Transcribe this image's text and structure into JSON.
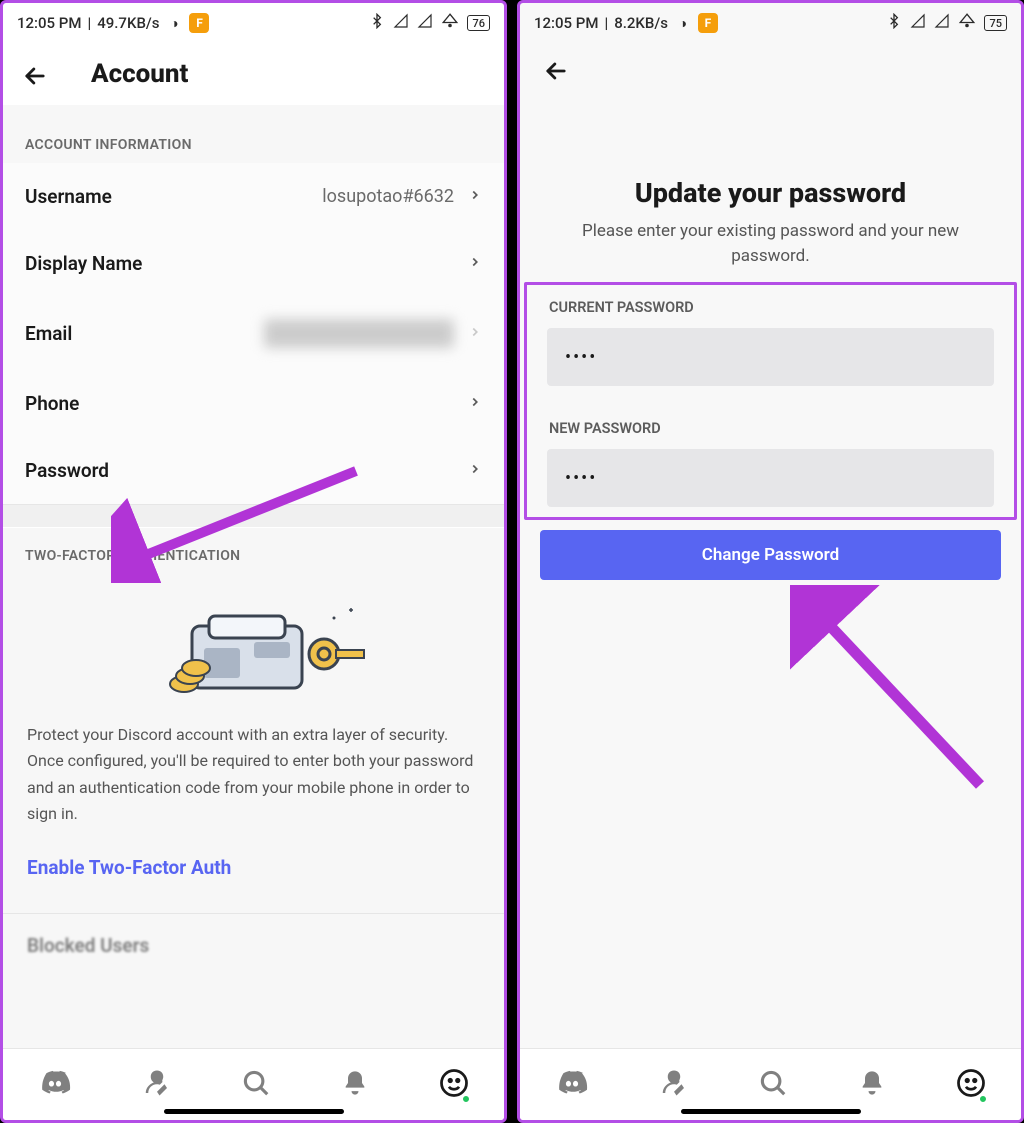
{
  "status": {
    "time": "12:05 PM",
    "left_rate": "49.7KB/s",
    "right_rate": "8.2KB/s",
    "battery_left": "76",
    "battery_right": "75"
  },
  "left": {
    "header_title": "Account",
    "section_info": "ACCOUNT INFORMATION",
    "rows": {
      "username_label": "Username",
      "username_value": "losupotao#6632",
      "display_name_label": "Display Name",
      "email_label": "Email",
      "phone_label": "Phone",
      "password_label": "Password"
    },
    "twofa_section": "TWO-FACTOR AUTHENTICATION",
    "twofa_desc": "Protect your Discord account with an extra layer of security. Once configured, you'll be required to enter both your password and an authentication code from your mobile phone in order to sign in.",
    "twofa_link": "Enable Two-Factor Auth",
    "blocked_peek": "Blocked Users"
  },
  "right": {
    "title": "Update your password",
    "subtitle": "Please enter your existing password and your new password.",
    "current_label": "CURRENT PASSWORD",
    "new_label": "NEW PASSWORD",
    "current_value": "••••",
    "new_value": "••••",
    "button": "Change Password"
  }
}
